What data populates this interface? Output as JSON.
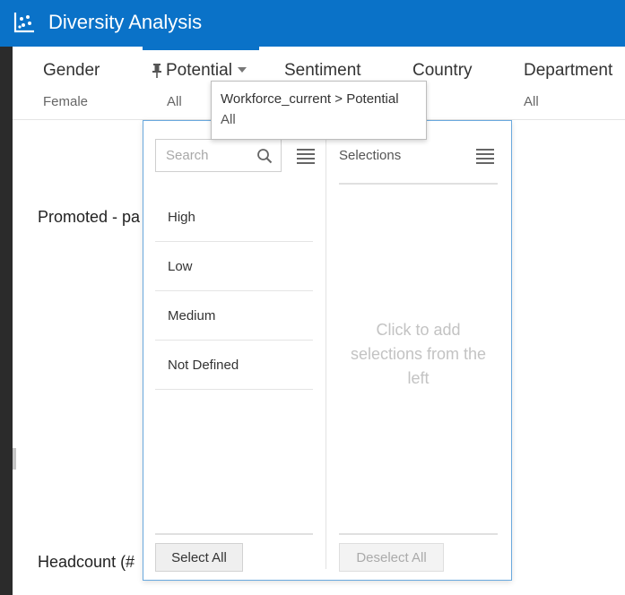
{
  "app": {
    "title": "Diversity Analysis",
    "accent_color": "#0a72c8"
  },
  "filters": [
    {
      "label": "Gender",
      "value": "Female"
    },
    {
      "label": "Potential",
      "value": "All",
      "pinned": true,
      "active": true
    },
    {
      "label": "Sentiment",
      "value": ""
    },
    {
      "label": "Country",
      "value": ""
    },
    {
      "label": "Department",
      "value": "All"
    }
  ],
  "tooltip": {
    "path": "Workforce_current > Potential",
    "value": "All"
  },
  "dropdown": {
    "search_placeholder": "Search",
    "options": [
      "High",
      "Low",
      "Medium",
      "Not Defined"
    ],
    "selections_title": "Selections",
    "selections_empty": "Click to add selections from the left",
    "select_all_label": "Select All",
    "deselect_all_label": "Deselect All"
  },
  "content": {
    "promoted_label": "Promoted - pa",
    "headcount_label": "Headcount (#"
  },
  "icons": {
    "app_logo": "scatter-chart-icon",
    "pin": "pin-icon",
    "caret": "caret-down-icon",
    "search": "search-icon",
    "menu": "hamburger-menu-icon"
  }
}
